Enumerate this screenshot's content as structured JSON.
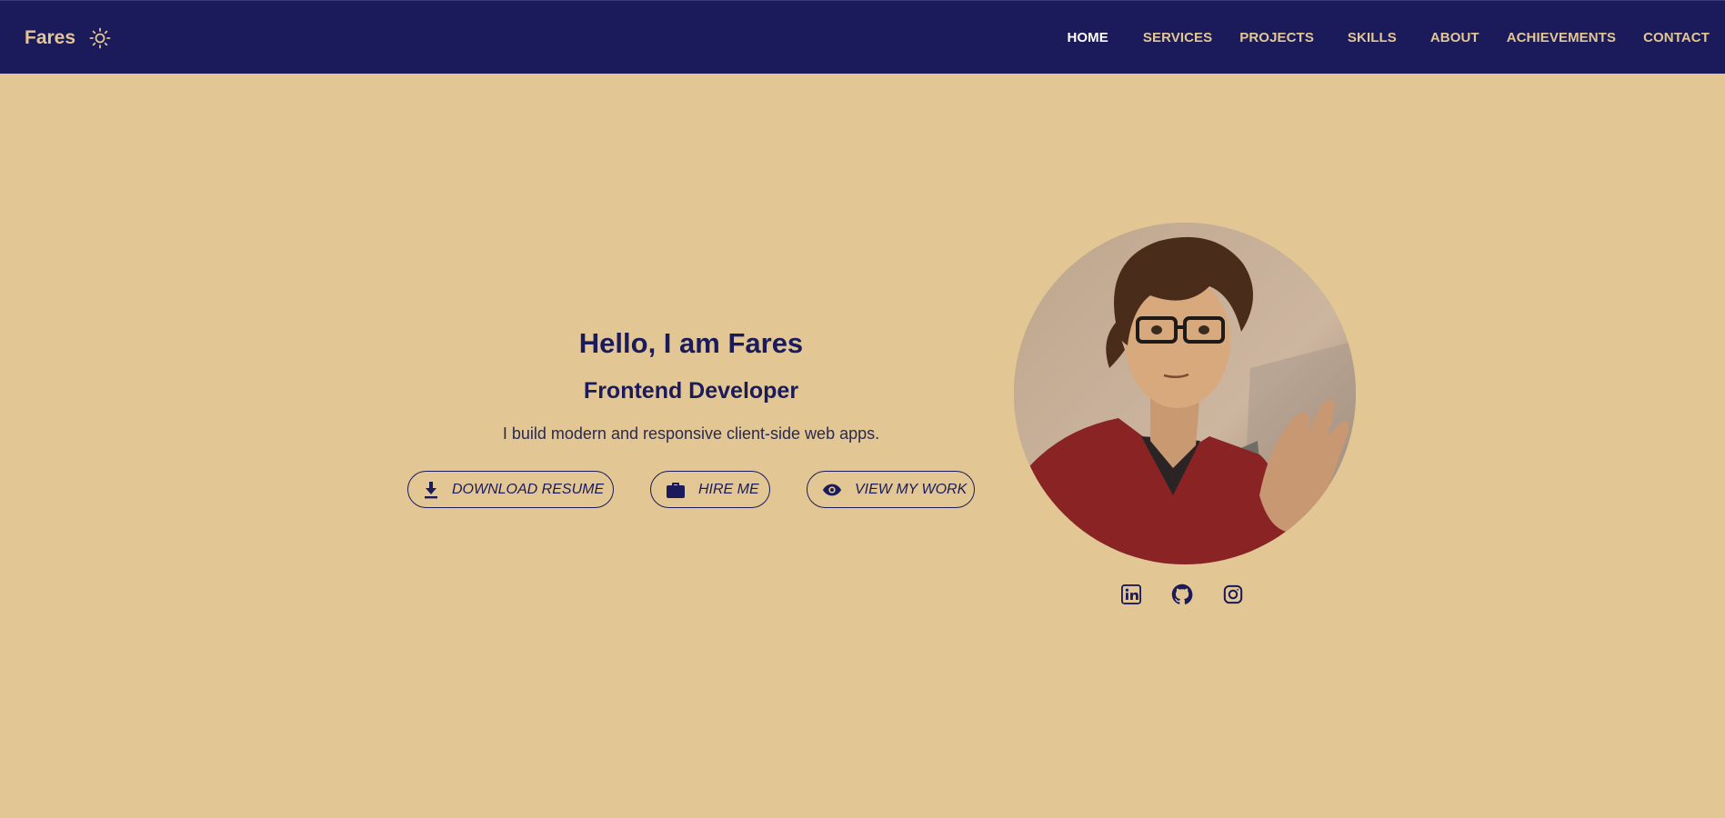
{
  "header": {
    "brand": "Fares",
    "theme_icon": "sun-icon",
    "nav": [
      {
        "label": "HOME",
        "active": true
      },
      {
        "label": "SERVICES",
        "active": false
      },
      {
        "label": "PROJECTS",
        "active": false
      },
      {
        "label": "SKILLS",
        "active": false
      },
      {
        "label": "ABOUT",
        "active": false
      },
      {
        "label": "ACHIEVEMENTS",
        "active": false
      },
      {
        "label": "CONTACT",
        "active": false
      }
    ]
  },
  "hero": {
    "title": "Hello, I am Fares",
    "subtitle": "Frontend Developer",
    "tagline": "I build modern and responsive client-side web apps.",
    "buttons": [
      {
        "label": "DOWNLOAD RESUME",
        "icon": "download-icon"
      },
      {
        "label": "HIRE ME",
        "icon": "briefcase-icon"
      },
      {
        "label": "VIEW MY WORK",
        "icon": "eye-icon"
      }
    ]
  },
  "profile": {
    "avatar": "avatar-illustration",
    "socials": [
      {
        "name": "linkedin",
        "icon": "linkedin-icon"
      },
      {
        "name": "github",
        "icon": "github-icon"
      },
      {
        "name": "instagram",
        "icon": "instagram-icon"
      }
    ]
  },
  "colors": {
    "navy": "#1b1a5a",
    "sand": "#e2c794",
    "active_nav": "#ffffff"
  }
}
